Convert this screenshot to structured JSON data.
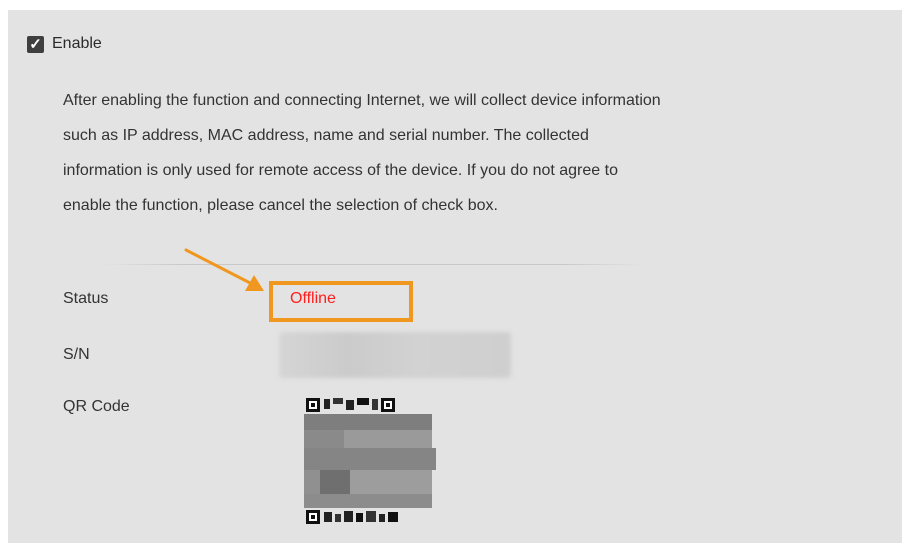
{
  "enable": {
    "label": "Enable",
    "checked": true
  },
  "description": {
    "lines": [
      "After enabling the function and connecting Internet, we will collect device information",
      "such as IP address, MAC address, name and serial number. The collected",
      "information is only used for remote access of the device. If you do not agree to",
      "enable the function, please cancel the selection of check box."
    ]
  },
  "fields": {
    "status_label": "Status",
    "status_value": "Offline",
    "sn_label": "S/N",
    "qr_label": "QR Code"
  },
  "colors": {
    "panel_bg": "#e3e3e3",
    "status_offline": "#ff1f1f",
    "highlight": "#f0971f"
  },
  "icons": {
    "checkbox": "checkmark-icon",
    "annotation": "arrow-icon"
  }
}
